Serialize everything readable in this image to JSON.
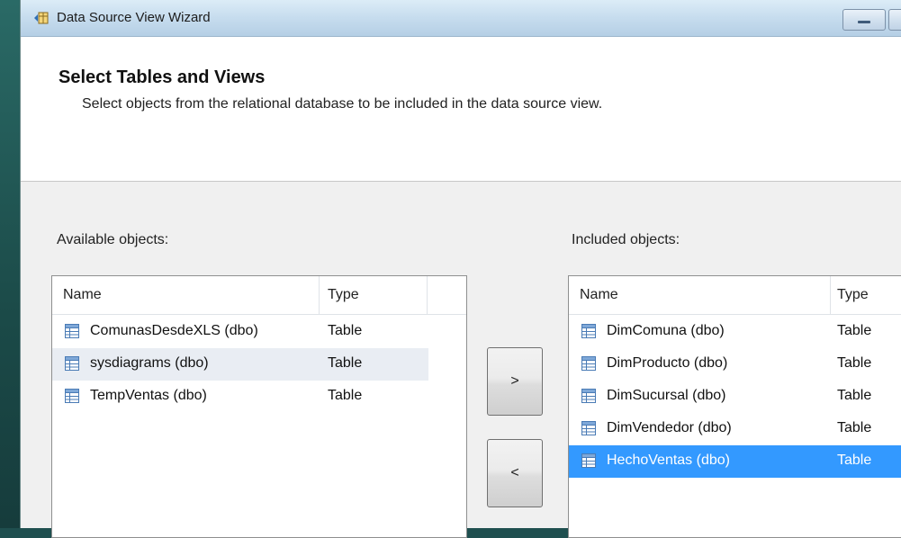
{
  "window": {
    "title": "Data Source View Wizard"
  },
  "header": {
    "title": "Select Tables and Views",
    "subtitle": "Select objects from the relational database to be included in the data source view."
  },
  "available": {
    "label": "Available objects:",
    "columns": [
      "Name",
      "Type"
    ],
    "rows": [
      {
        "name": "ComunasDesdeXLS (dbo)",
        "type": "Table"
      },
      {
        "name": "sysdiagrams (dbo)",
        "type": "Table"
      },
      {
        "name": "TempVentas (dbo)",
        "type": "Table"
      }
    ]
  },
  "included": {
    "label": "Included objects:",
    "columns": [
      "Name",
      "Type"
    ],
    "rows": [
      {
        "name": "DimComuna (dbo)",
        "type": "Table"
      },
      {
        "name": "DimProducto (dbo)",
        "type": "Table"
      },
      {
        "name": "DimSucursal (dbo)",
        "type": "Table"
      },
      {
        "name": "DimVendedor (dbo)",
        "type": "Table"
      },
      {
        "name": "HechoVentas (dbo)",
        "type": "Table"
      }
    ],
    "selected_row": "HechoVentas (dbo)"
  },
  "buttons": {
    "add_label": ">",
    "remove_label": "<"
  },
  "icons": {
    "title_icon": "wizard-app-icon",
    "row_icon": "table-grid-icon"
  },
  "colors": {
    "selection": "#3399ff",
    "hover_row": "#e9edf3",
    "titlebar": "#c6dcee"
  }
}
